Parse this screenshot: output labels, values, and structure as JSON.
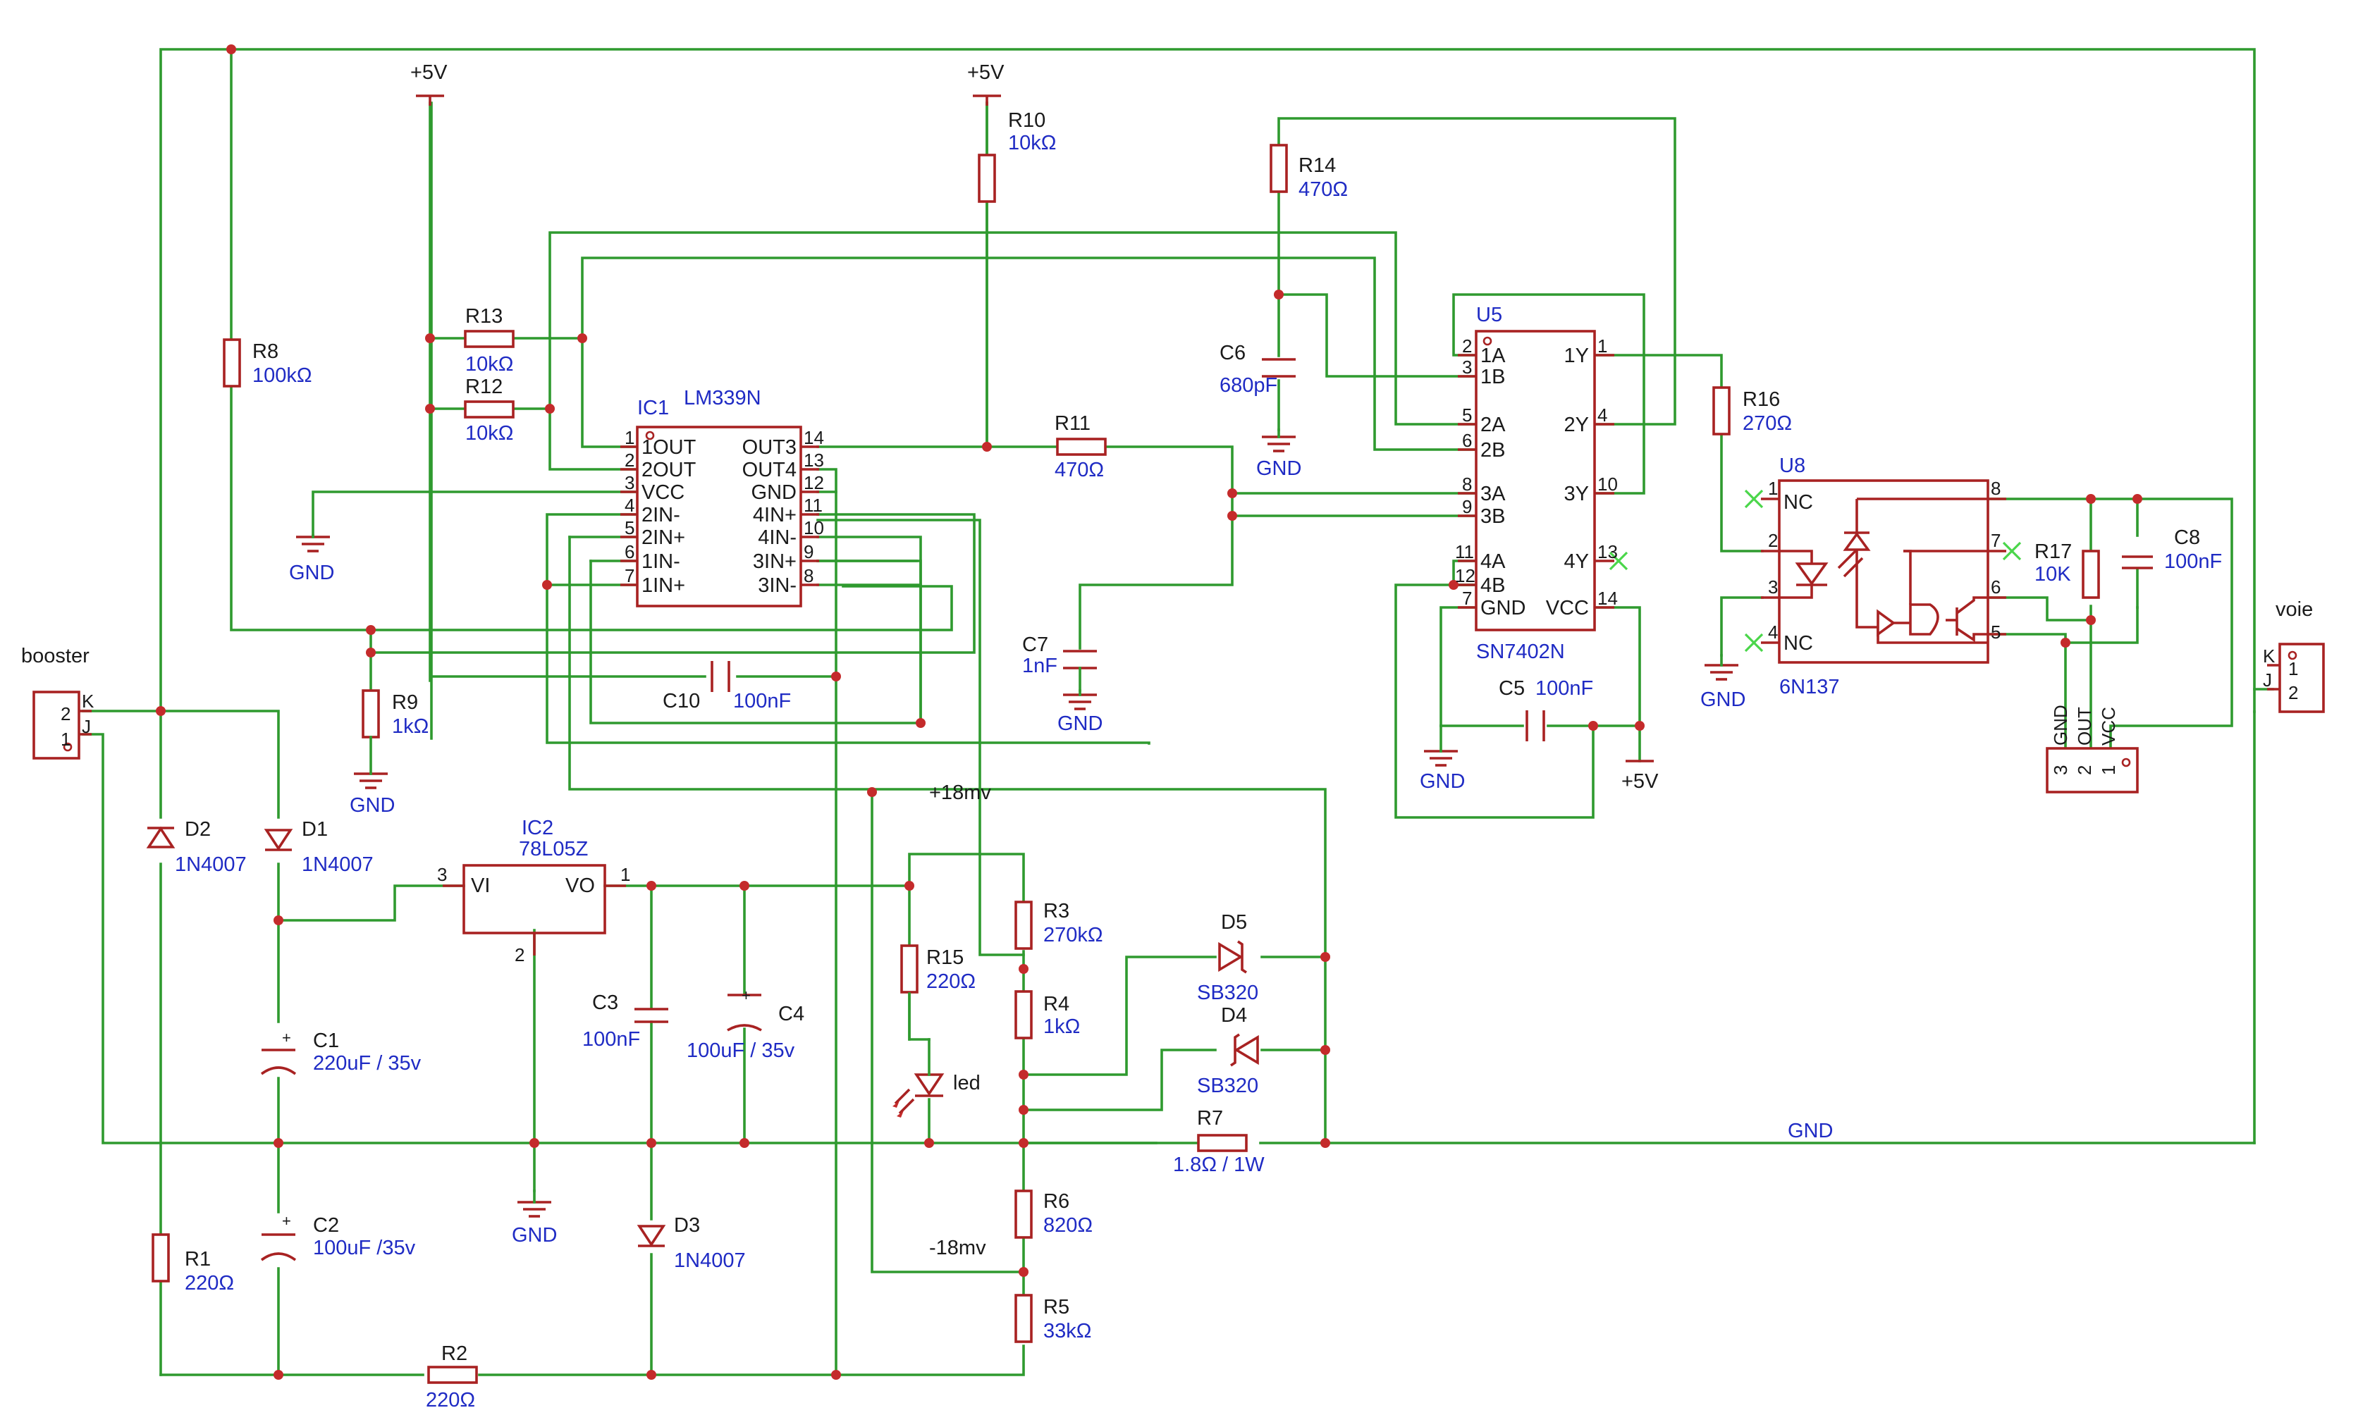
{
  "schematic": {
    "power_labels": {
      "vcc_left": "+5V",
      "vcc_right": "+5V",
      "vcc_u5": "+5V",
      "gnd_main": "GND",
      "pos18": "+18mv",
      "neg18": "-18mv"
    },
    "gnd_labels": [
      "GND",
      "GND",
      "GND",
      "GND",
      "GND",
      "GND",
      "GND",
      "GND"
    ],
    "connectors": {
      "booster": {
        "name": "booster",
        "pins": [
          "2",
          "1"
        ],
        "pin_names": [
          "K",
          "J"
        ]
      },
      "voie": {
        "name": "voie",
        "pins": [
          "1",
          "2"
        ],
        "pin_names": [
          "K",
          "J"
        ]
      },
      "u8out": {
        "pins": [
          "3",
          "2",
          "1"
        ],
        "pin_names": [
          "GND",
          "OUT",
          "VCC"
        ]
      }
    },
    "resistors": [
      {
        "ref": "R1",
        "value": "220Ω"
      },
      {
        "ref": "R2",
        "value": "220Ω"
      },
      {
        "ref": "R3",
        "value": "270kΩ"
      },
      {
        "ref": "R4",
        "value": "1kΩ"
      },
      {
        "ref": "R5",
        "value": "33kΩ"
      },
      {
        "ref": "R6",
        "value": "820Ω"
      },
      {
        "ref": "R7",
        "value": "1.8Ω / 1W"
      },
      {
        "ref": "R8",
        "value": "100kΩ"
      },
      {
        "ref": "R9",
        "value": "1kΩ"
      },
      {
        "ref": "R10",
        "value": "10kΩ"
      },
      {
        "ref": "R11",
        "value": "470Ω"
      },
      {
        "ref": "R12",
        "value": "10kΩ"
      },
      {
        "ref": "R13",
        "value": "10kΩ"
      },
      {
        "ref": "R14",
        "value": "470Ω"
      },
      {
        "ref": "R15",
        "value": "220Ω"
      },
      {
        "ref": "R16",
        "value": "270Ω"
      },
      {
        "ref": "R17",
        "value": "10K"
      }
    ],
    "capacitors": [
      {
        "ref": "C1",
        "value": "220uF / 35v"
      },
      {
        "ref": "C2",
        "value": "100uF /35v"
      },
      {
        "ref": "C3",
        "value": "100nF"
      },
      {
        "ref": "C4",
        "value": "100uF / 35v"
      },
      {
        "ref": "C5",
        "value": "100nF"
      },
      {
        "ref": "C6",
        "value": "680pF"
      },
      {
        "ref": "C7",
        "value": "1nF"
      },
      {
        "ref": "C8",
        "value": "100nF"
      },
      {
        "ref": "C10",
        "value": "100nF"
      }
    ],
    "diodes": [
      {
        "ref": "D1",
        "value": "1N4007"
      },
      {
        "ref": "D2",
        "value": "1N4007"
      },
      {
        "ref": "D3",
        "value": "1N4007"
      },
      {
        "ref": "D4",
        "value": "SB320"
      },
      {
        "ref": "D5",
        "value": "SB320"
      },
      {
        "ref": "",
        "value": "led"
      }
    ],
    "ic1": {
      "ref": "IC1",
      "value": "LM339N",
      "left_pins": [
        {
          "num": "1",
          "name": "1OUT"
        },
        {
          "num": "2",
          "name": "2OUT"
        },
        {
          "num": "3",
          "name": "VCC"
        },
        {
          "num": "4",
          "name": "2IN-"
        },
        {
          "num": "5",
          "name": "2IN+"
        },
        {
          "num": "6",
          "name": "1IN-"
        },
        {
          "num": "7",
          "name": "1IN+"
        }
      ],
      "right_pins": [
        {
          "num": "14",
          "name": "OUT3"
        },
        {
          "num": "13",
          "name": "OUT4"
        },
        {
          "num": "12",
          "name": "GND"
        },
        {
          "num": "11",
          "name": "4IN+"
        },
        {
          "num": "10",
          "name": "4IN-"
        },
        {
          "num": "9",
          "name": "3IN+"
        },
        {
          "num": "8",
          "name": "3IN-"
        }
      ]
    },
    "ic2": {
      "ref": "IC2",
      "value": "78L05Z",
      "vi": "VI",
      "vo": "VO",
      "pin_vi": "3",
      "pin_vo": "1",
      "pin_gnd": "2"
    },
    "u5": {
      "ref": "U5",
      "value": "SN7402N",
      "left_pins": [
        {
          "num": "2",
          "name": "1A"
        },
        {
          "num": "3",
          "name": "1B"
        },
        {
          "num": "5",
          "name": "2A"
        },
        {
          "num": "6",
          "name": "2B"
        },
        {
          "num": "8",
          "name": "3A"
        },
        {
          "num": "9",
          "name": "3B"
        },
        {
          "num": "11",
          "name": "4A"
        },
        {
          "num": "12",
          "name": "4B"
        },
        {
          "num": "7",
          "name": "GND"
        }
      ],
      "right_pins": [
        {
          "num": "1",
          "name": "1Y"
        },
        {
          "num": "4",
          "name": "2Y"
        },
        {
          "num": "10",
          "name": "3Y"
        },
        {
          "num": "13",
          "name": "4Y"
        },
        {
          "num": "14",
          "name": "VCC"
        }
      ]
    },
    "u8": {
      "ref": "U8",
      "value": "6N137",
      "pins": [
        "1",
        "2",
        "3",
        "4",
        "5",
        "6",
        "7",
        "8"
      ],
      "nc1": "NC",
      "nc4": "NC"
    }
  }
}
